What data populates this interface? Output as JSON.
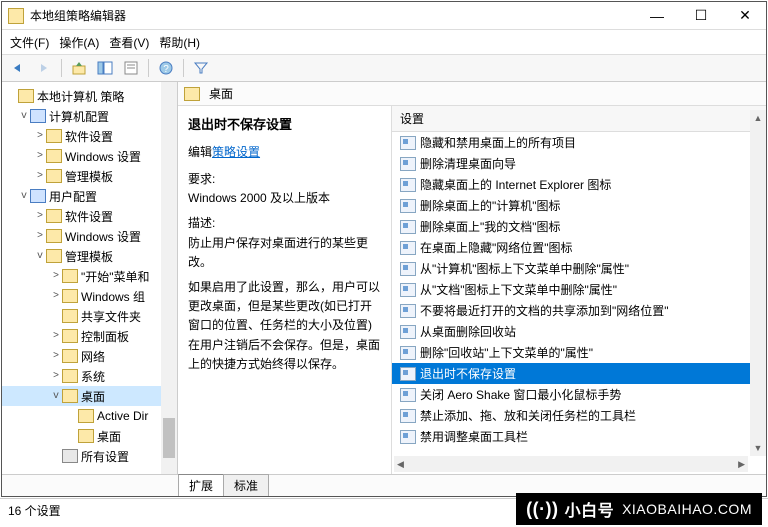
{
  "window": {
    "title": "本地组策略编辑器",
    "min": "—",
    "max": "☐",
    "close": "✕"
  },
  "menu": {
    "file": "文件(F)",
    "action": "操作(A)",
    "view": "查看(V)",
    "help": "帮助(H)"
  },
  "tree": {
    "root": "本地计算机 策略",
    "computer": "计算机配置",
    "c_software": "软件设置",
    "c_windows": "Windows 设置",
    "c_admin": "管理模板",
    "user": "用户配置",
    "u_software": "软件设置",
    "u_windows": "Windows 设置",
    "u_admin": "管理模板",
    "start": "\"开始\"菜单和",
    "wincomp": "Windows 组",
    "shared": "共享文件夹",
    "ctrlpanel": "控制面板",
    "network": "网络",
    "system": "系统",
    "desktop": "桌面",
    "activedir": "Active Dir",
    "desktop2": "桌面",
    "allsettings": "所有设置"
  },
  "path": {
    "folder": "桌面"
  },
  "detail": {
    "title": "退出时不保存设置",
    "edit_prefix": "编辑",
    "edit_link": "策略设置",
    "req_label": "要求:",
    "req_value": "Windows 2000 及以上版本",
    "desc_label": "描述:",
    "desc1": "防止用户保存对桌面进行的某些更改。",
    "desc2": "如果启用了此设置，那么，用户可以更改桌面，但是某些更改(如已打开窗口的位置、任务栏的大小及位置)在用户注销后不会保存。但是，桌面上的快捷方式始终得以保存。"
  },
  "list": {
    "header": "设置",
    "items": [
      "隐藏和禁用桌面上的所有项目",
      "删除清理桌面向导",
      "隐藏桌面上的 Internet Explorer 图标",
      "删除桌面上的\"计算机\"图标",
      "删除桌面上\"我的文档\"图标",
      "在桌面上隐藏\"网络位置\"图标",
      "从\"计算机\"图标上下文菜单中删除\"属性\"",
      "从\"文档\"图标上下文菜单中删除\"属性\"",
      "不要将最近打开的文档的共享添加到\"网络位置\"",
      "从桌面删除回收站",
      "删除\"回收站\"上下文菜单的\"属性\"",
      "退出时不保存设置",
      "关闭 Aero Shake 窗口最小化鼠标手势",
      "禁止添加、拖、放和关闭任务栏的工具栏",
      "禁用调整桌面工具栏"
    ],
    "selected_index": 11
  },
  "tabs": {
    "extended": "扩展",
    "standard": "标准"
  },
  "status": "16 个设置",
  "watermark": {
    "brand": "小白号",
    "url": "XIAOBAIHAO.COM"
  }
}
